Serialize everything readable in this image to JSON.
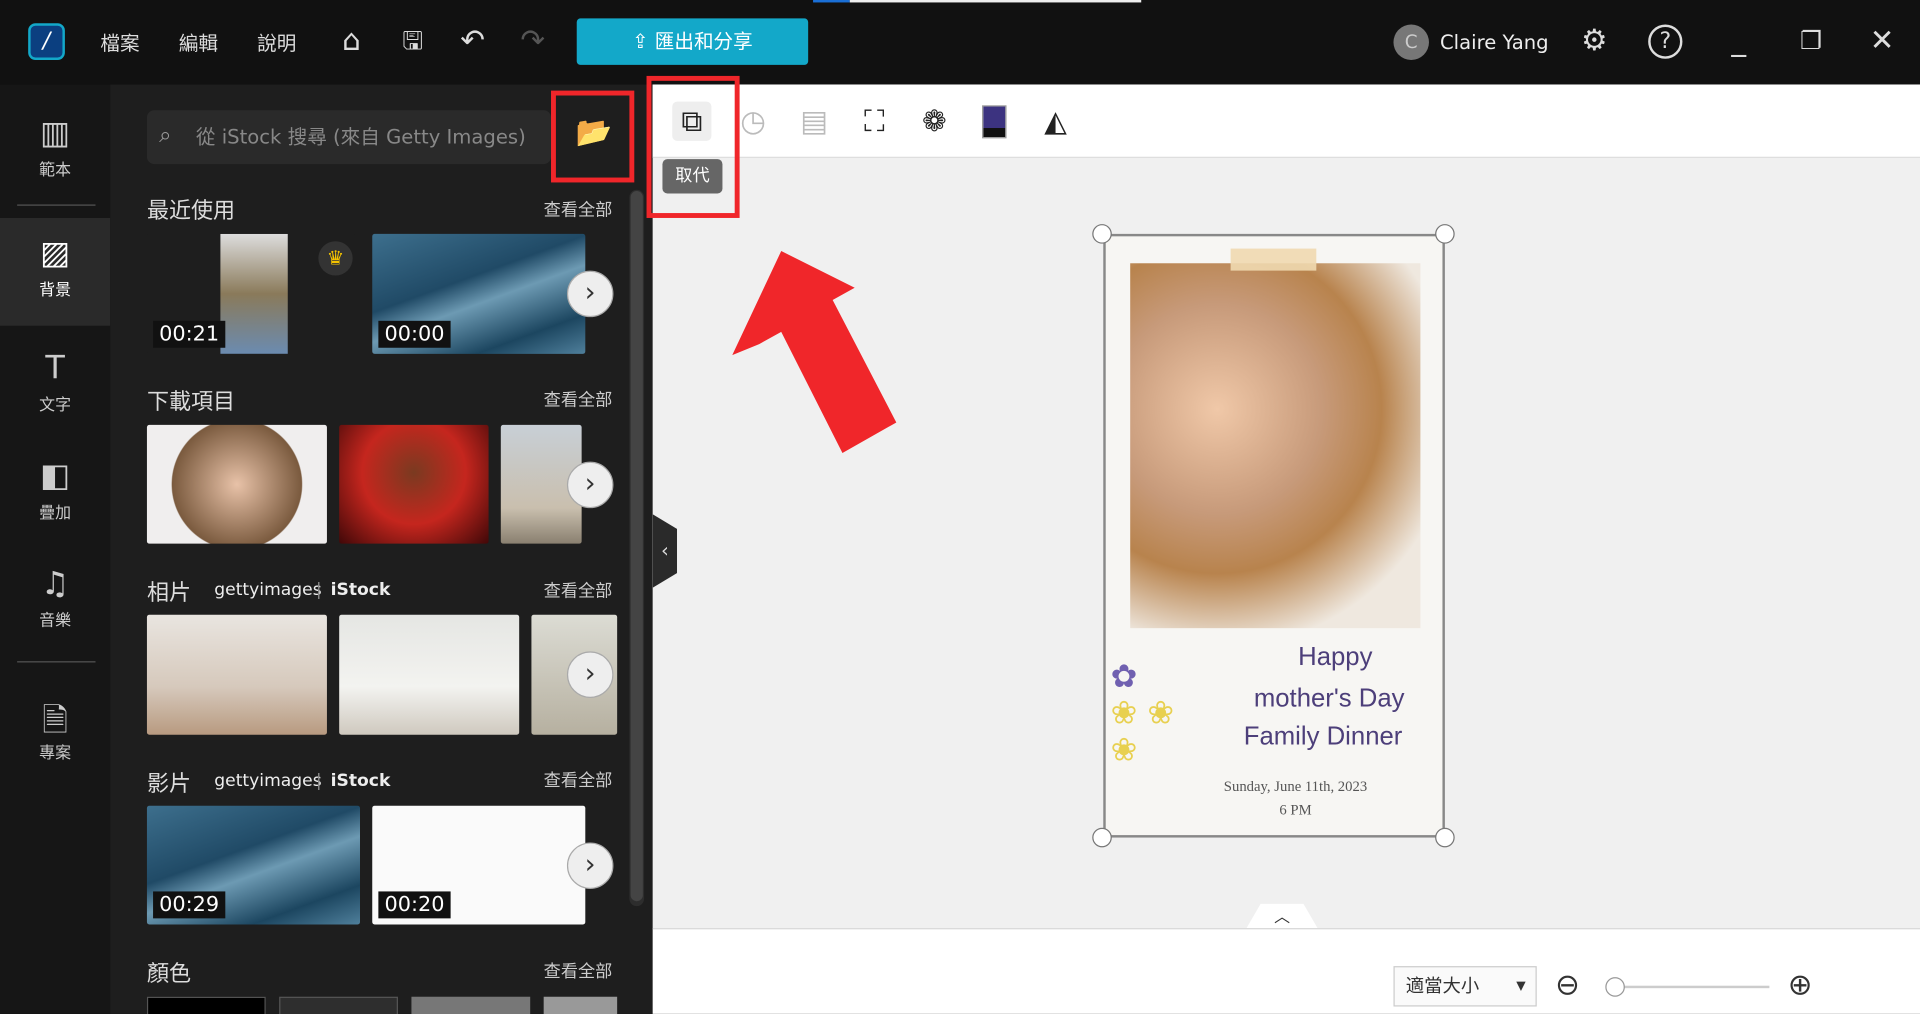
{
  "menu": {
    "file": "檔案",
    "edit": "編輯",
    "help": "說明"
  },
  "export_label": "匯出和分享",
  "user": {
    "initial": "C",
    "name": "Claire Yang"
  },
  "nav": [
    {
      "label": "範本"
    },
    {
      "label": "背景"
    },
    {
      "label": "文字"
    },
    {
      "label": "疊加"
    },
    {
      "label": "音樂"
    },
    {
      "label": "專案"
    }
  ],
  "search": {
    "placeholder": "從 iStock 搜尋 (來自 Getty Images)"
  },
  "sections": {
    "recent": {
      "title": "最近使用",
      "see_all": "查看全部",
      "durations": [
        "00:21",
        "00:00"
      ]
    },
    "downloads": {
      "title": "下載項目",
      "see_all": "查看全部"
    },
    "photos": {
      "title": "相片",
      "brand1": "gettyimages",
      "brand2": "iStock",
      "see_all": "查看全部"
    },
    "videos": {
      "title": "影片",
      "brand1": "gettyimages",
      "brand2": "iStock",
      "see_all": "查看全部",
      "durations": [
        "00:29",
        "00:20"
      ]
    },
    "colors": {
      "title": "顏色",
      "see_all": "查看全部"
    }
  },
  "tooltip": "取代",
  "card": {
    "line1": "Happy",
    "line2": "mother's Day",
    "line3": "Family Dinner",
    "date": "Sunday, June 11th, 2023",
    "time": "6 PM"
  },
  "zoom_select": "適當大小",
  "colors": {
    "accent": "#13a8c9",
    "highlight": "#f0262a"
  }
}
